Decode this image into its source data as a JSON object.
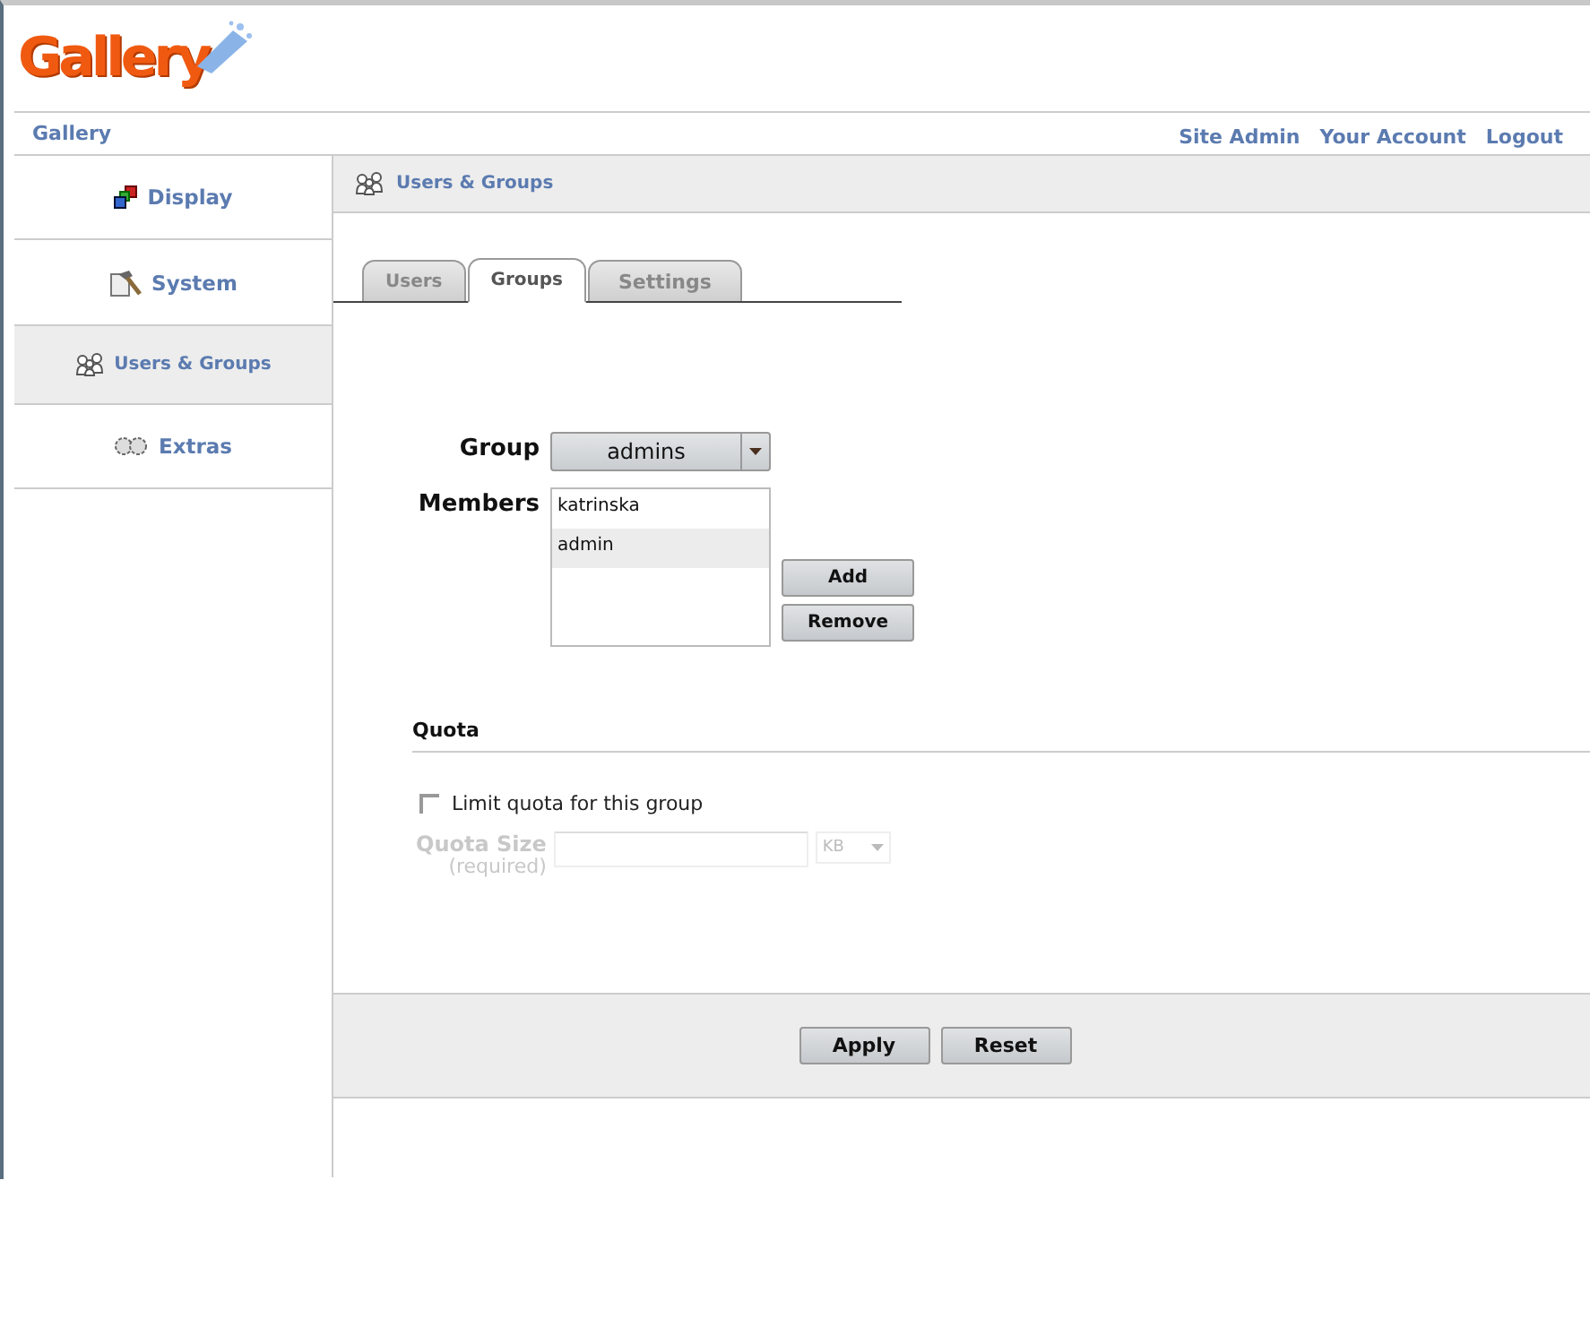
{
  "logo": {
    "text": "Gallery"
  },
  "breadcrumb": "Gallery",
  "top_links": [
    "Site Admin",
    "Your Account",
    "Logout"
  ],
  "sidebar": {
    "items": [
      {
        "label": "Display",
        "kind": "display",
        "selected": false
      },
      {
        "label": "System",
        "kind": "system",
        "selected": false
      },
      {
        "label": "Users & Groups",
        "kind": "users",
        "selected": true
      },
      {
        "label": "Extras",
        "kind": "extras",
        "selected": false
      }
    ]
  },
  "page_header": {
    "title": "Users & Groups"
  },
  "tabs": [
    {
      "label": "Users",
      "selected": false
    },
    {
      "label": "Groups",
      "selected": true
    },
    {
      "label": "Settings",
      "selected": false
    }
  ],
  "group_field": {
    "label": "Group",
    "value": "admins"
  },
  "members": {
    "label": "Members",
    "items": [
      {
        "name": "katrinska",
        "selected": false
      },
      {
        "name": "admin",
        "selected": true
      }
    ]
  },
  "member_buttons": [
    "Add",
    "Remove"
  ],
  "quota": {
    "heading": "Quota",
    "limit": {
      "label": "Limit quota for this group",
      "checked": false
    },
    "size": {
      "label": "Quota Size",
      "hint": "(required)",
      "unit": "KB",
      "disabled": true
    }
  },
  "footer_buttons": [
    "Apply",
    "Reset"
  ]
}
